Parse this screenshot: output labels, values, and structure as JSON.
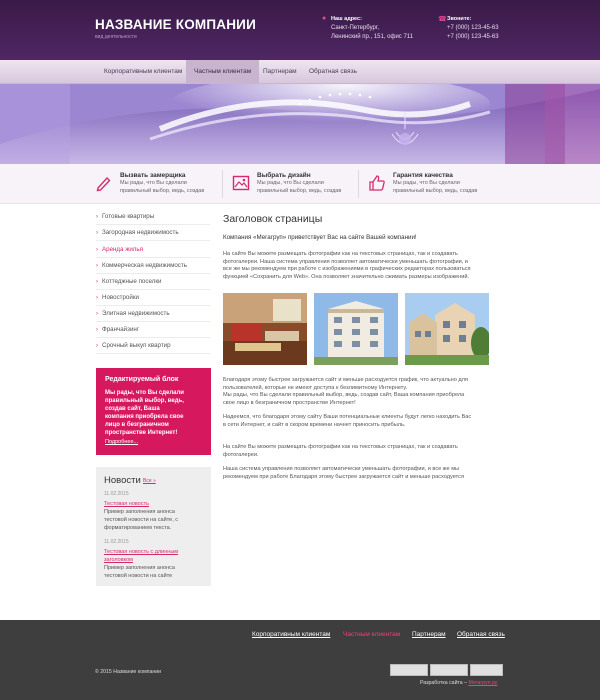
{
  "header": {
    "company": "НАЗВАНИЕ КОМПАНИИ",
    "activity": "вид деятельности",
    "address_label": "Наш адрес:",
    "address_line1": "Санкт-Петербург,",
    "address_line2": "Ленинский пр., 151, офис 711",
    "phone_label": "Звоните:",
    "phone1": "+7 (000) 123-45-63",
    "phone2": "+7 (000) 123-45-63"
  },
  "nav": {
    "items": [
      {
        "label": "Корпоративным клиентам"
      },
      {
        "label": "Частным клиентам"
      },
      {
        "label": "Партнерам"
      },
      {
        "label": "Обратная связь"
      }
    ]
  },
  "features": [
    {
      "title": "Вызвать замерщика",
      "line1": "Мы рады, что Вы сделали",
      "line2": "правильный выбор, ведь, создав"
    },
    {
      "title": "Выбрать дизайн",
      "line1": "Мы рады, что Вы сделали",
      "line2": "правильный выбор, ведь, создав"
    },
    {
      "title": "Гарантия качества",
      "line1": "Мы рады, что Вы сделали",
      "line2": "правильный выбор, ведь, создав"
    }
  ],
  "sidebar": {
    "items": [
      {
        "label": "Готовые квартиры"
      },
      {
        "label": "Загородная недвижимость"
      },
      {
        "label": "Аренда жилья"
      },
      {
        "label": "Коммерческая недвижимость"
      },
      {
        "label": "Коттеджные поселки"
      },
      {
        "label": "Новостройки"
      },
      {
        "label": "Элитная недвижимость"
      },
      {
        "label": "Франчайзинг"
      },
      {
        "label": "Срочный выкуп квартир"
      }
    ],
    "active_index": 2
  },
  "promo": {
    "title": "Редактируемый блок",
    "line1": "Мы рады, что Вы сделали",
    "line2": "правильный выбор, ведь,",
    "line3": "создав сайт, Ваша",
    "line4": "компания приобрела свое",
    "line5": "лицо в безграничном",
    "line6": "пространстве Интернет!",
    "more": "Подробнее..."
  },
  "news": {
    "title": "Новости",
    "all": "Все »",
    "items": [
      {
        "date": "11.02.2015",
        "link1": "Тестовая новость",
        "link2": "",
        "text1": "Пример заполнения анонса",
        "text2": "тестовой новости на сайте, с",
        "text3": "форматированием текста."
      },
      {
        "date": "11.02.2015",
        "link1": "Тестовая новость с длинным",
        "link2": "заголовком",
        "text1": "Пример заполнения анонса",
        "text2": "тестовой новости на сайте",
        "text3": ""
      }
    ]
  },
  "main": {
    "title": "Заголовок страницы",
    "intro": "Компания «Мегагруп» приветствует Вас на сайте Вашей компании!",
    "p1": [
      "На сайте Вы можете размещать фотографии как на текстовых страницах, так и создавать",
      "фотогалереи. Наша система управления позволяет автоматически уменьшать фотографии, и",
      "все же мы рекомендуем при работе с изображениями в графических редакторах пользоваться",
      "функцией «Сохранить для Web». Она позволяет значительно сжимать размеры изображений."
    ],
    "p2": [
      "Благодаря этому быстрее загружается сайт и меньше расходуется график, что актуально для",
      "пользователей, которые не имеют доступа к безлимитному Интернету.",
      "Мы рады, что Вы сделали правильный выбор, ведь, создав сайт, Ваша компания приобрела",
      "свое лицо в безграничном пространстве Интернет!"
    ],
    "p3": [
      "Надеемся, что благодаря этому сайту Ваши потенциальные клиенты будут легко находить Вас",
      "в сети Интернет, и сайт в скором времени начнет приносить прибыль."
    ],
    "p4": [
      "На сайте Вы можете размещать фотографии как на текстовых страницах, так и создавать",
      "фотогалереи."
    ],
    "p5": [
      "Наша система управления позволяет автоматически уменьшать фотографии, и все же мы",
      "рекомендуем при работе Благодаря этому быстрее загружается сайт и меньше расходуется"
    ]
  },
  "footer": {
    "links": [
      {
        "label": "Корпоративным клиентам"
      },
      {
        "label": "Частным клиентам"
      },
      {
        "label": "Партнерам"
      },
      {
        "label": "Обратная связь"
      }
    ],
    "copyright": "© 2015 Название компании",
    "dev_label": "Разработка сайта –",
    "dev_link": "Мегагруп.ру"
  },
  "colors": {
    "accent": "#d62a6e",
    "header_bg": "#4e2763",
    "footer_bg": "#3e3e3e",
    "promo_bg": "#d6185f"
  }
}
